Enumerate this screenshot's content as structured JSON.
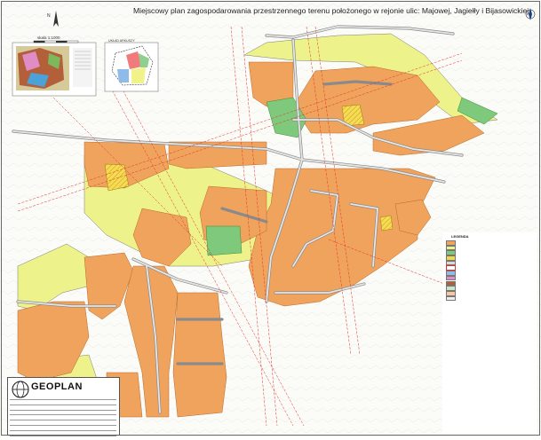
{
  "map": {
    "title": "Miejscowy plan zagospodarowania przestrzennego terenu położonego w rejonie ulic: Majowej, Jagiełły i Bijasowickiej",
    "north_label": "N",
    "scale_label": "skala 1:1000",
    "inset_label": "UKŁAD ARKUSZY",
    "legend_title": "LEGENDA",
    "company_name": "GEOPLAN",
    "colors": {
      "residential": "#f0a35c",
      "residential_outline": "#b8682c",
      "open_land": "#eef28a",
      "green": "#7fc97c",
      "hatched": "#f4d64a",
      "road": "#d8d8d8",
      "road_outline": "#8a8a8a",
      "redline": "#e4302a",
      "border": "#7a7a7a"
    }
  }
}
